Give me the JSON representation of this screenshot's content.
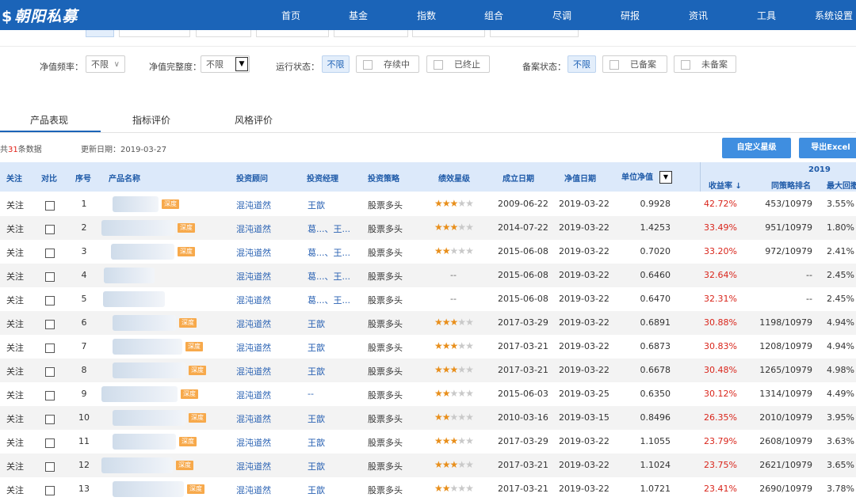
{
  "nav": {
    "logo": "朝阳私募",
    "items": [
      "首页",
      "基金",
      "指数",
      "组合",
      "尽调",
      "研报",
      "资讯",
      "工具",
      "系统设置"
    ]
  },
  "filters": {
    "nav_freq_label": "净值频率：",
    "nav_freq_value": "不限",
    "nav_complete_label": "净值完整度：",
    "nav_complete_value": "不限",
    "run_status_label": "运行状态：",
    "run_status_options": [
      "不限",
      "存续中",
      "已终止"
    ],
    "record_status_label": "备案状态：",
    "record_status_options": [
      "不限",
      "已备案",
      "未备案"
    ]
  },
  "tabs": [
    "产品表现",
    "指标评价",
    "风格评价"
  ],
  "info": {
    "count_prefix": "共",
    "count": "31",
    "count_suffix": "条数据",
    "update_label": "更新日期：2019-03-27"
  },
  "buttons": {
    "custom_rating": "自定义星级",
    "export": "导出Excel"
  },
  "table": {
    "headers": {
      "follow": "关注",
      "compare": "对比",
      "index": "序号",
      "name": "产品名称",
      "advisor": "投资顾问",
      "manager": "投资经理",
      "strategy": "投资策略",
      "rating": "绩效星级",
      "founded": "成立日期",
      "nav_date": "净值日期",
      "unit_nav": "单位净值",
      "year": "2019",
      "return": "收益率",
      "rank": "同策略排名",
      "max_dd": "最大回撤"
    },
    "badge_label": "深度",
    "rows": [
      {
        "follow": "关注",
        "idx": "1",
        "advisor": "混沌道然",
        "manager": "王歆",
        "strategy": "股票多头",
        "stars": 3,
        "founded": "2009-06-22",
        "nav_date": "2019-03-22",
        "nav": "0.9928",
        "ret": "42.72%",
        "rank": "453/10979",
        "dd": "3.55%",
        "badge": true
      },
      {
        "follow": "关注",
        "idx": "2",
        "advisor": "混沌道然",
        "manager": "葛...、王...",
        "strategy": "股票多头",
        "stars": 3,
        "founded": "2014-07-22",
        "nav_date": "2019-03-22",
        "nav": "1.4253",
        "ret": "33.49%",
        "rank": "951/10979",
        "dd": "1.80%",
        "badge": true
      },
      {
        "follow": "关注",
        "idx": "3",
        "advisor": "混沌道然",
        "manager": "葛...、王...",
        "strategy": "股票多头",
        "stars": 2,
        "founded": "2015-06-08",
        "nav_date": "2019-03-22",
        "nav": "0.7020",
        "ret": "33.20%",
        "rank": "972/10979",
        "dd": "2.41%",
        "badge": true
      },
      {
        "follow": "关注",
        "idx": "4",
        "advisor": "混沌道然",
        "manager": "葛...、王...",
        "strategy": "股票多头",
        "stars": 0,
        "founded": "2015-06-08",
        "nav_date": "2019-03-22",
        "nav": "0.6460",
        "ret": "32.64%",
        "rank": "--",
        "dd": "2.45%",
        "badge": false
      },
      {
        "follow": "关注",
        "idx": "5",
        "advisor": "混沌道然",
        "manager": "葛...、王...",
        "strategy": "股票多头",
        "stars": 0,
        "founded": "2015-06-08",
        "nav_date": "2019-03-22",
        "nav": "0.6470",
        "ret": "32.31%",
        "rank": "--",
        "dd": "2.45%",
        "badge": false
      },
      {
        "follow": "关注",
        "idx": "6",
        "advisor": "混沌道然",
        "manager": "王歆",
        "strategy": "股票多头",
        "stars": 3,
        "founded": "2017-03-29",
        "nav_date": "2019-03-22",
        "nav": "0.6891",
        "ret": "30.88%",
        "rank": "1198/10979",
        "dd": "4.94%",
        "badge": true
      },
      {
        "follow": "关注",
        "idx": "7",
        "advisor": "混沌道然",
        "manager": "王歆",
        "strategy": "股票多头",
        "stars": 3,
        "founded": "2017-03-21",
        "nav_date": "2019-03-22",
        "nav": "0.6873",
        "ret": "30.83%",
        "rank": "1208/10979",
        "dd": "4.94%",
        "badge": true
      },
      {
        "follow": "关注",
        "idx": "8",
        "advisor": "混沌道然",
        "manager": "王歆",
        "strategy": "股票多头",
        "stars": 3,
        "founded": "2017-03-21",
        "nav_date": "2019-03-22",
        "nav": "0.6678",
        "ret": "30.48%",
        "rank": "1265/10979",
        "dd": "4.98%",
        "badge": true
      },
      {
        "follow": "关注",
        "idx": "9",
        "advisor": "混沌道然",
        "manager": "--",
        "strategy": "股票多头",
        "stars": 2,
        "founded": "2015-06-03",
        "nav_date": "2019-03-25",
        "nav": "0.6350",
        "ret": "30.12%",
        "rank": "1314/10979",
        "dd": "4.49%",
        "badge": true
      },
      {
        "follow": "关注",
        "idx": "10",
        "advisor": "混沌道然",
        "manager": "王歆",
        "strategy": "股票多头",
        "stars": 2,
        "founded": "2010-03-16",
        "nav_date": "2019-03-15",
        "nav": "0.8496",
        "ret": "26.35%",
        "rank": "2010/10979",
        "dd": "3.95%",
        "badge": true
      },
      {
        "follow": "关注",
        "idx": "11",
        "advisor": "混沌道然",
        "manager": "王歆",
        "strategy": "股票多头",
        "stars": 3,
        "founded": "2017-03-29",
        "nav_date": "2019-03-22",
        "nav": "1.1055",
        "ret": "23.79%",
        "rank": "2608/10979",
        "dd": "3.63%",
        "badge": true
      },
      {
        "follow": "关注",
        "idx": "12",
        "advisor": "混沌道然",
        "manager": "王歆",
        "strategy": "股票多头",
        "stars": 3,
        "founded": "2017-03-21",
        "nav_date": "2019-03-22",
        "nav": "1.1024",
        "ret": "23.75%",
        "rank": "2621/10979",
        "dd": "3.65%",
        "badge": true
      },
      {
        "follow": "关注",
        "idx": "13",
        "advisor": "混沌道然",
        "manager": "王歆",
        "strategy": "股票多头",
        "stars": 2,
        "founded": "2017-03-21",
        "nav_date": "2019-03-22",
        "nav": "1.0721",
        "ret": "23.41%",
        "rank": "2690/10979",
        "dd": "3.78%",
        "badge": true
      }
    ]
  },
  "colors": {
    "nav_bg": "#1b64b8",
    "header_bg": "#dce9fa",
    "accent": "#3f8ee0",
    "return_red": "#d9261c",
    "star": "#e88f1c"
  }
}
